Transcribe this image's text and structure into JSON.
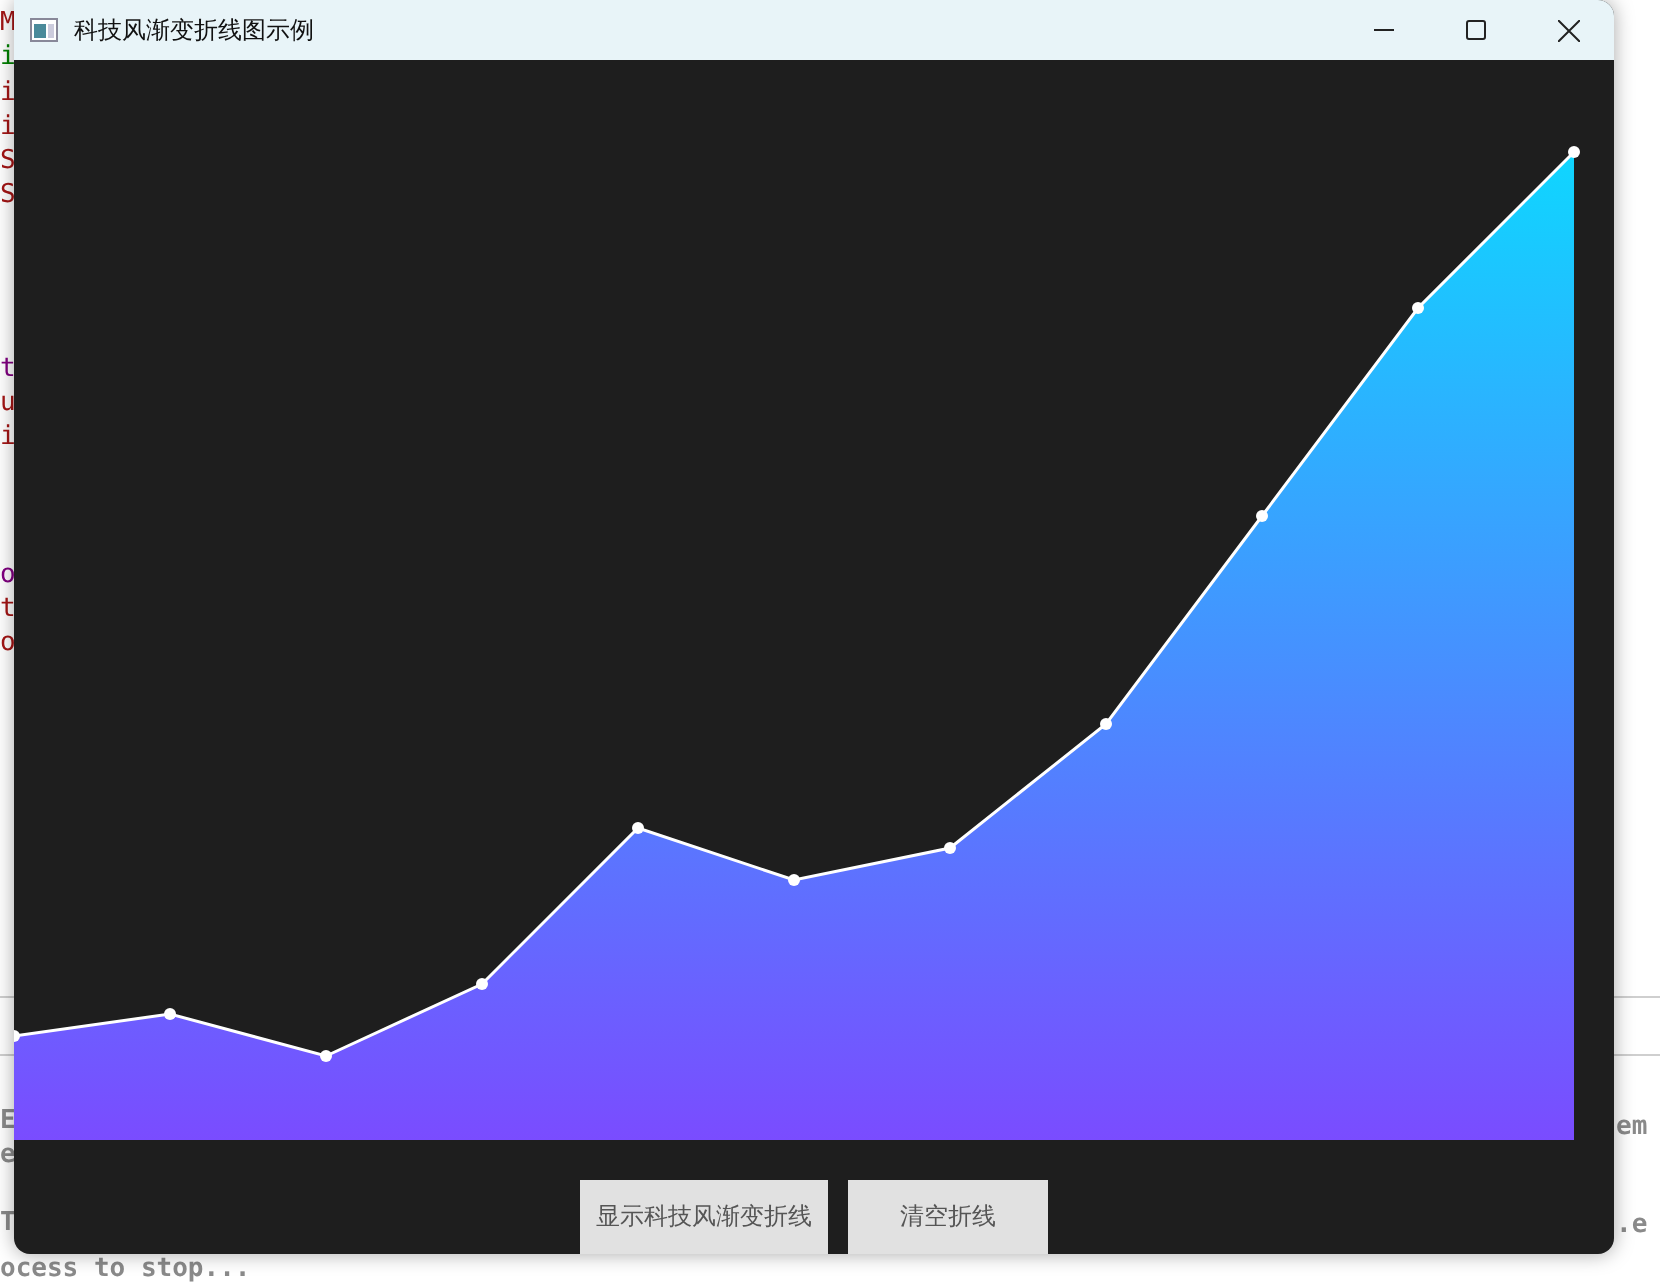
{
  "background": {
    "code_blocks": [
      [
        {
          "text": "M",
          "color": "#a31515"
        },
        {
          "text": "i",
          "color": "#008000"
        },
        {
          "text": "i",
          "color": "#a31515"
        },
        {
          "text": "i",
          "color": "#a31515"
        },
        {
          "text": "S",
          "color": "#a31515"
        },
        {
          "text": "S",
          "color": "#a31515"
        }
      ],
      [
        {
          "text": "t",
          "color": "#800080"
        },
        {
          "text": "u",
          "color": "#a31515"
        },
        {
          "text": "i",
          "color": "#a31515"
        }
      ],
      [
        {
          "text": "o",
          "color": "#800080"
        },
        {
          "text": "t",
          "color": "#a31515"
        },
        {
          "text": "o",
          "color": "#a31515"
        }
      ]
    ],
    "console_left": [
      [
        "E",
        "e"
      ],
      [
        "T",
        "ocess to stop..."
      ]
    ],
    "console_right": [
      "em",
      ".e"
    ]
  },
  "window": {
    "title": "科技风渐变折线图示例"
  },
  "buttons": [
    {
      "label": "显示科技风渐变折线"
    },
    {
      "label": "清空折线"
    }
  ]
}
